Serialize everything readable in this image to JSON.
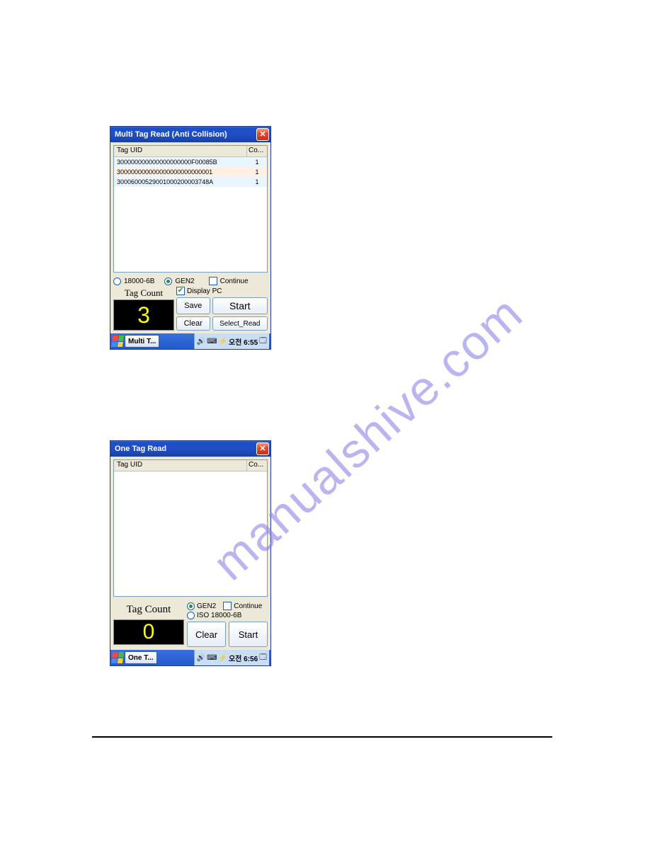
{
  "watermark": "manualshive.com",
  "window1": {
    "title": "Multi Tag Read (Anti Collision)",
    "list": {
      "col_uid": "Tag UID",
      "col_co": "Co...",
      "rows": [
        {
          "uid": "300000000000000000000F00085B",
          "co": "1"
        },
        {
          "uid": "300000000000000000000000001",
          "co": "1"
        },
        {
          "uid": "30006000529001000200003748A",
          "co": "1"
        }
      ]
    },
    "radios": {
      "r1": "18000-6B",
      "r2": "GEN2"
    },
    "checks": {
      "c1": "Continue",
      "c2": "Display PC"
    },
    "tagcount_label": "Tag Count",
    "tagcount_value": "3",
    "buttons": {
      "save": "Save",
      "start": "Start",
      "clear": "Clear",
      "select_read": "Select_Read"
    },
    "taskbar": {
      "app": "Multi T...",
      "time": "오전 6:55"
    }
  },
  "window2": {
    "title": "One Tag Read",
    "list": {
      "col_uid": "Tag UID",
      "col_co": "Co..."
    },
    "radios": {
      "r1": "GEN2",
      "r2": "ISO 18000-6B"
    },
    "checks": {
      "c1": "Continue"
    },
    "tagcount_label": "Tag Count",
    "tagcount_value": "0",
    "buttons": {
      "clear": "Clear",
      "start": "Start"
    },
    "taskbar": {
      "app": "One T...",
      "time": "오전 6:56"
    }
  }
}
